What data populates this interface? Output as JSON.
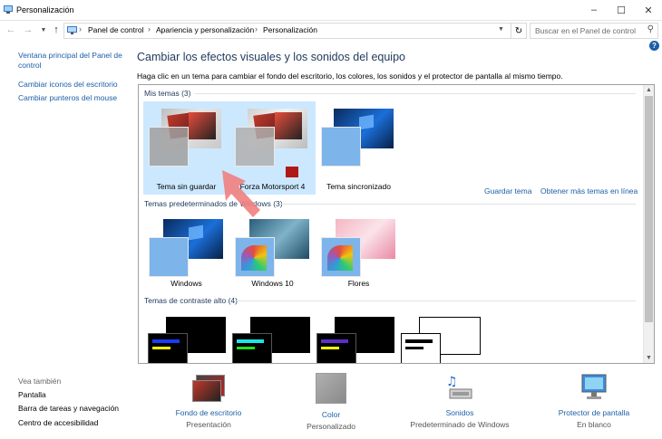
{
  "window": {
    "title": "Personalización"
  },
  "nav": {
    "breadcrumbs": [
      "Panel de control",
      "Apariencia y personalización",
      "Personalización"
    ],
    "search_placeholder": "Buscar en el Panel de control"
  },
  "sidebar": {
    "links": [
      "Ventana principal del Panel de control",
      "Cambiar iconos del escritorio",
      "Cambiar punteros del mouse"
    ],
    "see_also_label": "Vea también",
    "see_also": [
      "Pantalla",
      "Barra de tareas y navegación",
      "Centro de accesibilidad"
    ]
  },
  "main": {
    "heading": "Cambiar los efectos visuales y los sonidos del equipo",
    "subtext": "Haga clic en un tema para cambiar el fondo del escritorio, los colores, los sonidos y el protector de pantalla al mismo tiempo.",
    "save_theme": "Guardar tema",
    "more_themes": "Obtener más temas en línea",
    "groups": [
      {
        "title": "Mis temas (3)",
        "themes": [
          "Tema sin guardar",
          "Forza Motorsport 4",
          "Tema sincronizado"
        ]
      },
      {
        "title": "Temas predeterminados de Windows (3)",
        "themes": [
          "Windows",
          "Windows 10",
          "Flores"
        ]
      },
      {
        "title": "Temas de contraste alto (4)",
        "themes": [
          "",
          "",
          "",
          ""
        ]
      }
    ]
  },
  "bottom": [
    {
      "title": "Fondo de escritorio",
      "value": "Presentación",
      "icon": "desktop-background-icon"
    },
    {
      "title": "Color",
      "value": "Personalizado",
      "icon": "color-icon"
    },
    {
      "title": "Sonidos",
      "value": "Predeterminado de Windows",
      "icon": "sounds-icon"
    },
    {
      "title": "Protector de pantalla",
      "value": "En blanco",
      "icon": "screensaver-icon"
    }
  ],
  "colors": {
    "accent_link": "#1c5fa8",
    "heading": "#1e395b",
    "selection": "#cce8ff",
    "pointer_arrow": "#f08080"
  }
}
